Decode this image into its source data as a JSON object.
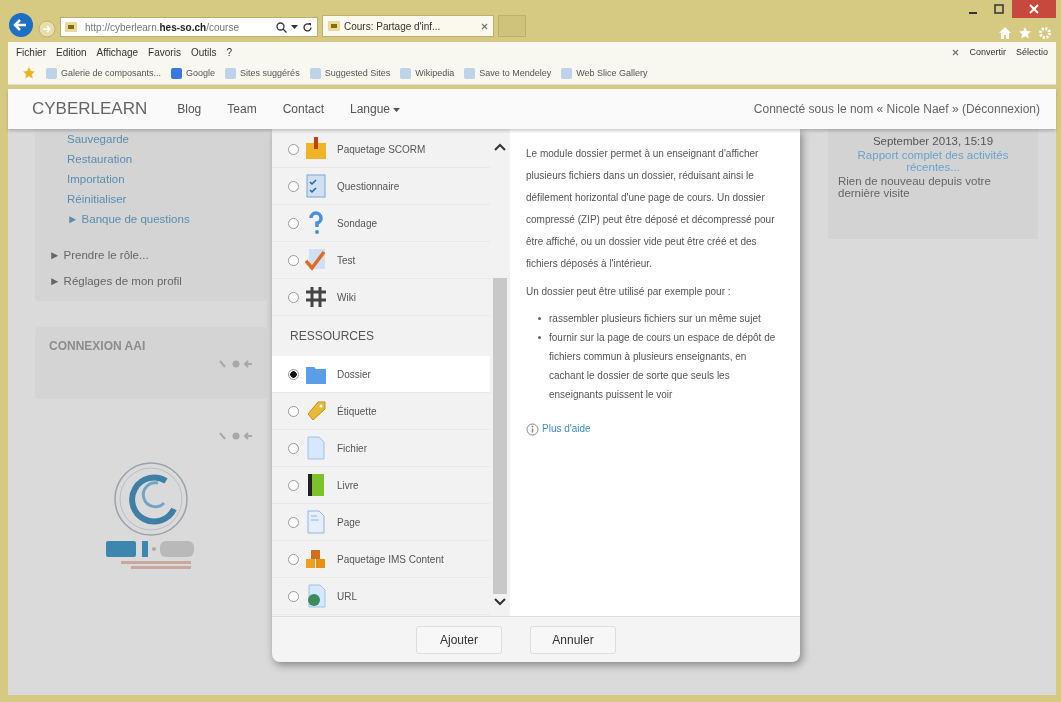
{
  "browser": {
    "address": "http://cyberlearn.**hes-so.ch**/course",
    "tab": {
      "title": "Cours: Partage d'inf...",
      "selected": true
    },
    "menu": [
      "Fichier",
      "Edition",
      "Affichage",
      "Favoris",
      "Outils",
      "?"
    ],
    "tools": [
      "Convertir",
      "Sélectio"
    ],
    "favorites": [
      "Galerie de composants...",
      "Google",
      "Sites suggérés",
      "Suggested Sites",
      "Wikipedia",
      "Save to Mendeley",
      "Web Slice Gallery"
    ]
  },
  "navbar": {
    "brand": "CYBERLEARN",
    "links": [
      "Blog",
      "Team",
      "Contact",
      "Langue"
    ],
    "user": "Connecté sous le nom « Nicole Naef » (Déconnexion)"
  },
  "sidebar": {
    "links": [
      "Sauvegarde",
      "Restauration",
      "Importation",
      "Réinitialiser"
    ],
    "sublink": "► Banque de questions",
    "items": [
      "► Prendre le rôle...",
      "► Réglages de mon profil"
    ],
    "block_title": "CONNEXION AAI"
  },
  "recent": {
    "date": "September 2013, 15:19",
    "link": "Rapport complet des activités récentes...",
    "note": "Rien de nouveau depuis votre dernière visite"
  },
  "modal": {
    "groups": [
      {
        "items": [
          {
            "label": "Paquetage SCORM",
            "selected": false
          },
          {
            "label": "Questionnaire",
            "selected": false
          },
          {
            "label": "Sondage",
            "selected": false
          },
          {
            "label": "Test",
            "selected": false
          },
          {
            "label": "Wiki",
            "selected": false
          }
        ]
      },
      {
        "title": "RESSOURCES",
        "items": [
          {
            "label": "Dossier",
            "selected": true
          },
          {
            "label": "Étiquette",
            "selected": false
          },
          {
            "label": "Fichier",
            "selected": false
          },
          {
            "label": "Livre",
            "selected": false
          },
          {
            "label": "Page",
            "selected": false
          },
          {
            "label": "Paquetage IMS Content",
            "selected": false
          },
          {
            "label": "URL",
            "selected": false
          }
        ]
      }
    ],
    "description": [
      "Le module dossier permet à un enseignant d'afficher plusieurs fichiers dans un dossier, réduisant ainsi le défilement horizontal d'une page de cours. Un dossier compressé (ZIP) peut être déposé et décompressé pour être affiché, ou un dossier vide peut être créé et des fichiers déposés à l'intérieur.",
      "Un dossier peut être utilisé par exemple pour :"
    ],
    "bullets": [
      "rassembler plusieurs fichiers sur un même sujet",
      "fournir sur la page de cours un espace de dépôt de fichiers commun à plusieurs enseignants, en cachant le dossier de sorte que seuls les enseignants puissent le voir"
    ],
    "help": "Plus d'aide",
    "buttons": [
      "Ajouter",
      "Annuler"
    ]
  }
}
